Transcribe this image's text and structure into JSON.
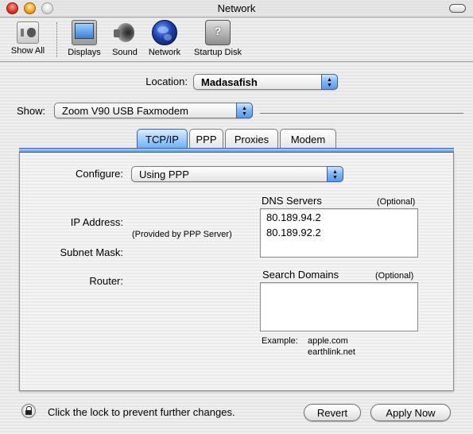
{
  "window": {
    "title": "Network"
  },
  "toolbar": {
    "items": [
      {
        "label": "Show All",
        "icon": "show-all-icon"
      },
      {
        "label": "Displays",
        "icon": "displays-icon"
      },
      {
        "label": "Sound",
        "icon": "sound-icon"
      },
      {
        "label": "Network",
        "icon": "network-globe-icon"
      },
      {
        "label": "Startup Disk",
        "icon": "startup-disk-icon"
      }
    ]
  },
  "location": {
    "label": "Location:",
    "value": "Madasafish"
  },
  "show": {
    "label": "Show:",
    "value": "Zoom V90 USB Faxmodem"
  },
  "tabs": [
    {
      "label": "TCP/IP",
      "active": true
    },
    {
      "label": "PPP",
      "active": false
    },
    {
      "label": "Proxies",
      "active": false
    },
    {
      "label": "Modem",
      "active": false
    }
  ],
  "tcpip": {
    "configure_label": "Configure:",
    "configure_value": "Using PPP",
    "ip_address_label": "IP Address:",
    "provided_note": "(Provided by PPP Server)",
    "subnet_mask_label": "Subnet Mask:",
    "router_label": "Router:",
    "dns": {
      "label": "DNS Servers",
      "optional": "(Optional)",
      "entries": [
        "80.189.94.2",
        "80.189.92.2"
      ]
    },
    "search_domains": {
      "label": "Search Domains",
      "optional": "(Optional)",
      "entries": []
    },
    "example": {
      "label": "Example:",
      "values": [
        "apple.com",
        "earthlink.net"
      ]
    }
  },
  "footer": {
    "lock_text": "Click the lock to prevent further changes.",
    "revert_label": "Revert",
    "apply_label": "Apply Now"
  },
  "colors": {
    "accent_blue": "#6eafef",
    "close_red": "#e0392a",
    "minimize_yellow": "#f6a623"
  }
}
